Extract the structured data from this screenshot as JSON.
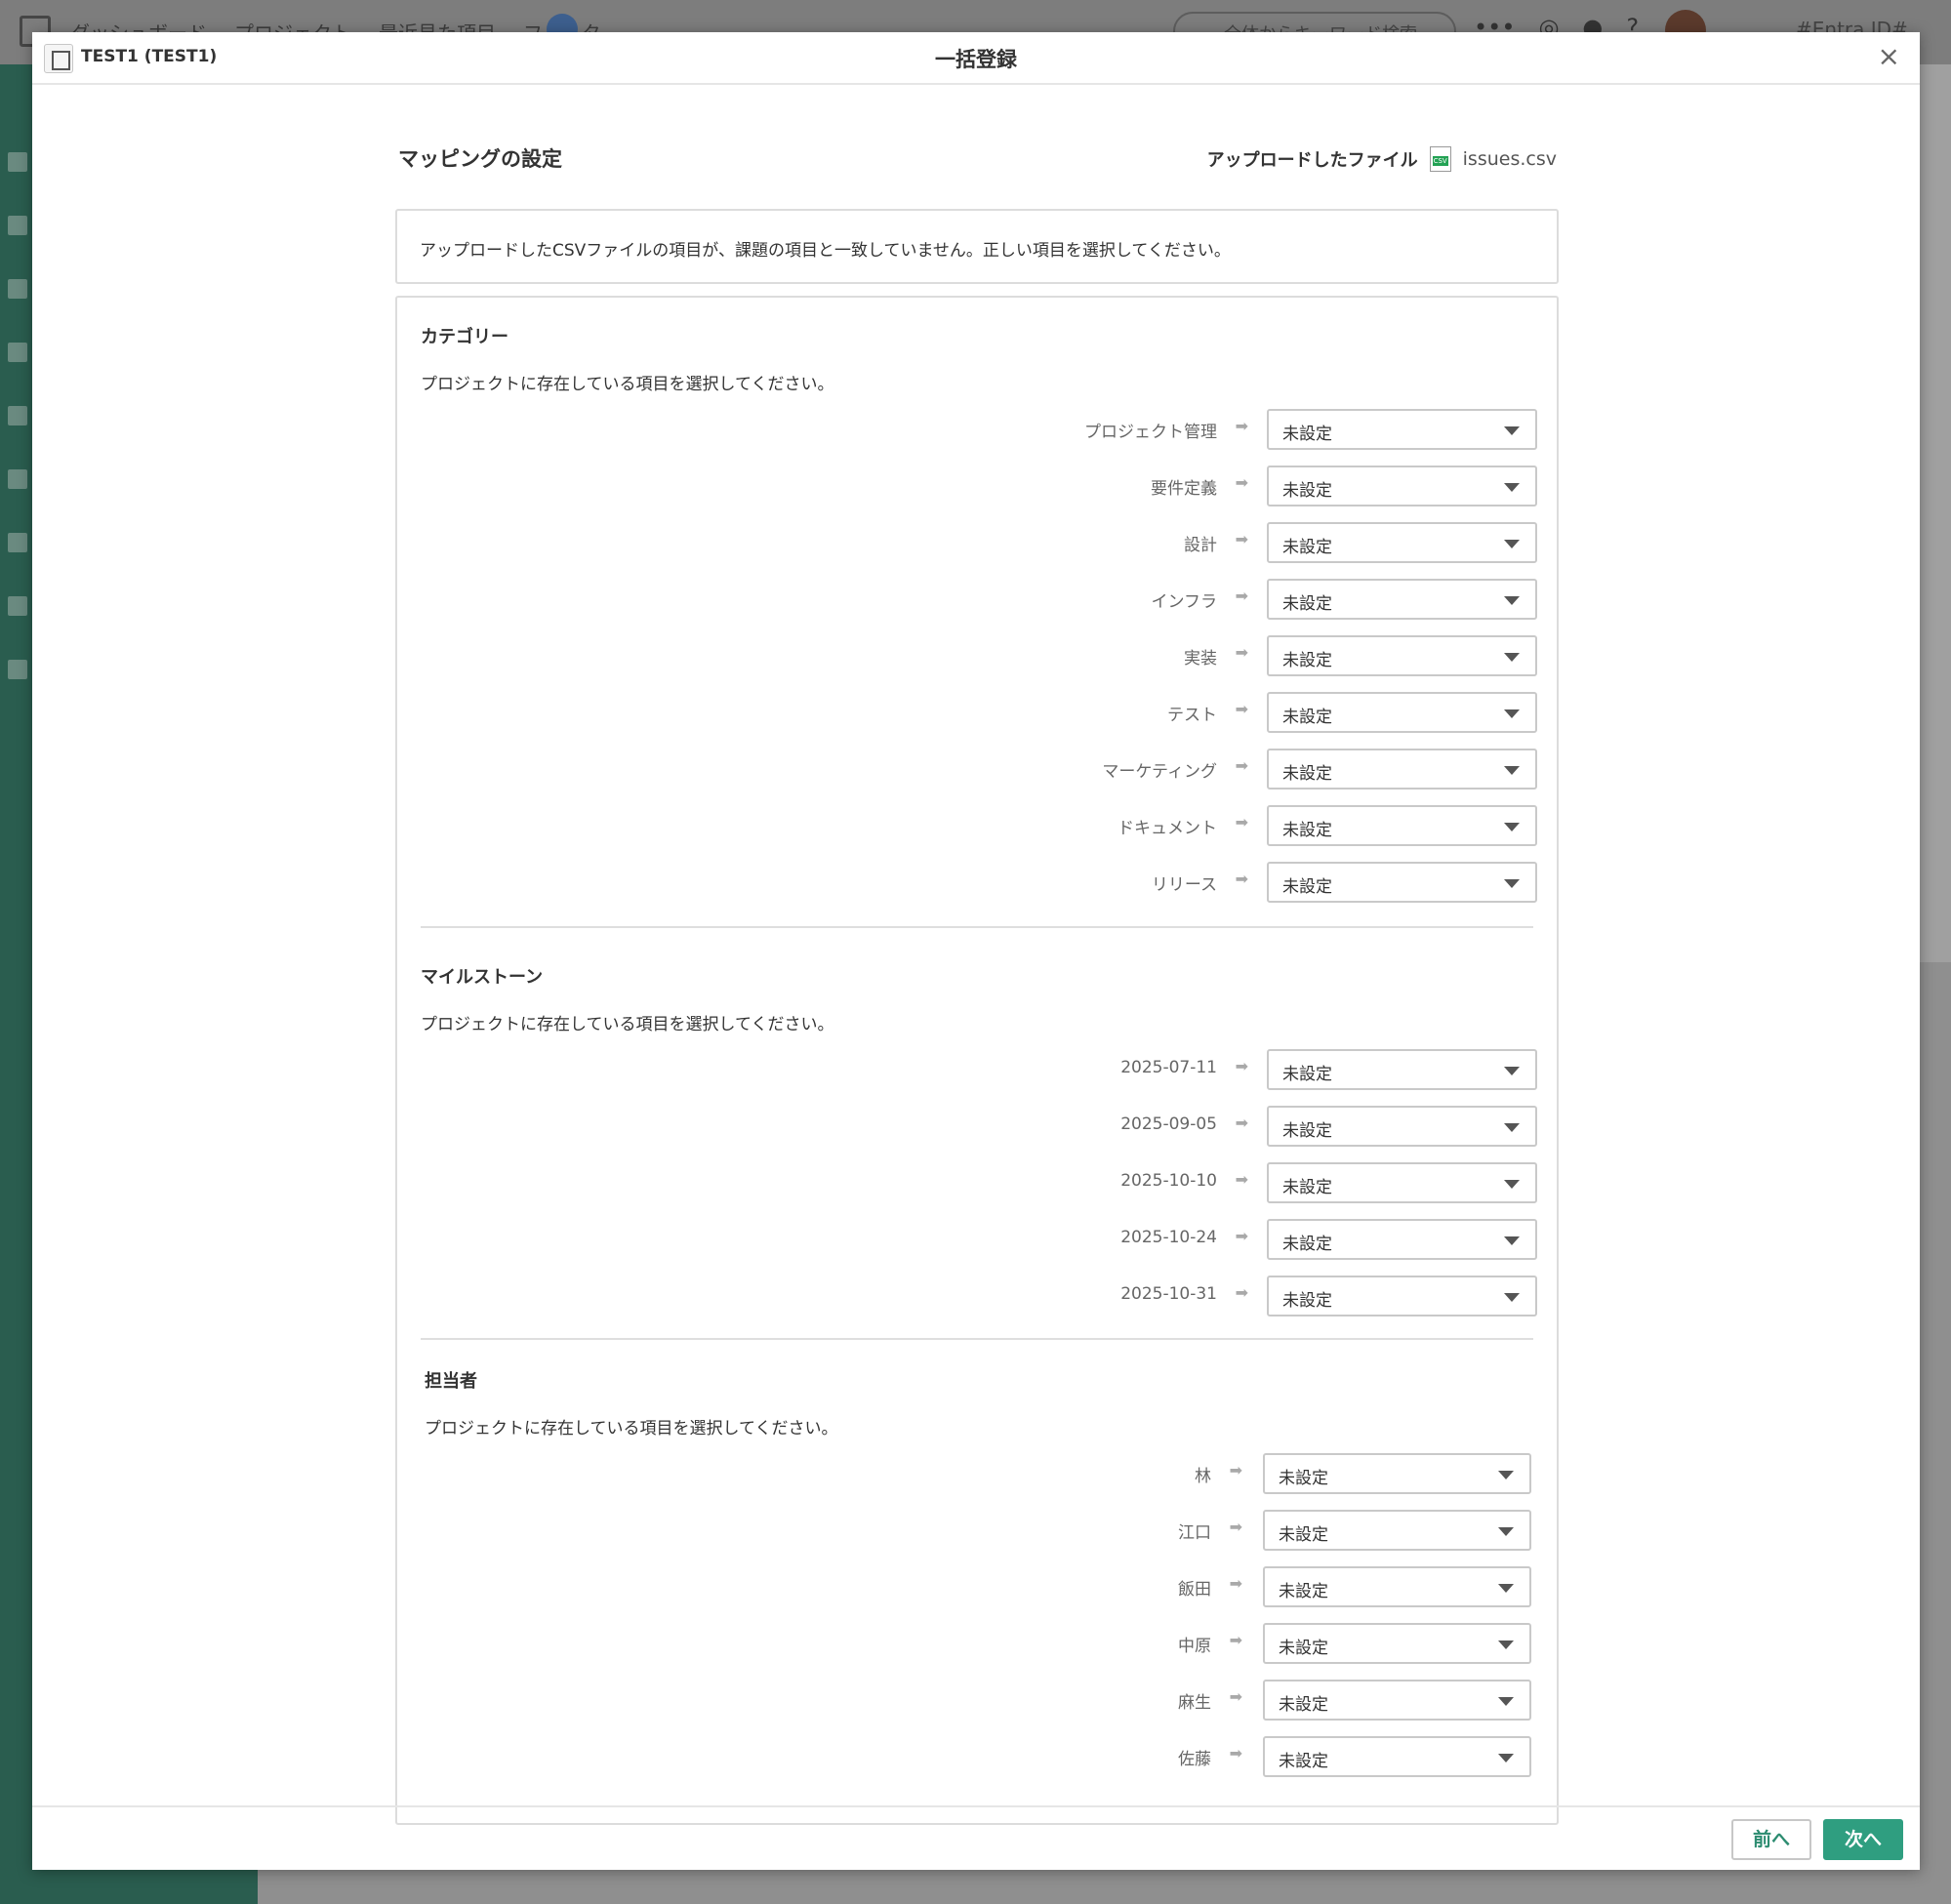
{
  "background": {
    "nav": [
      "ダッシュボード",
      "プロジェクト",
      "最近見た項目",
      "フィルタ"
    ],
    "search_placeholder": "全体からキーワード検索",
    "org_label": "#Entra ID#"
  },
  "modal": {
    "project_name": "TEST1 (TEST1)",
    "title": "一括登録",
    "close_label": "×"
  },
  "mapping": {
    "title": "マッピングの設定",
    "uploaded_label": "アップロードしたファイル",
    "file_name": "issues.csv",
    "notice": "アップロードしたCSVファイルの項目が、課題の項目と一致していません。正しい項目を選択してください。"
  },
  "sections": [
    {
      "title": "カテゴリー",
      "description": "プロジェクトに存在している項目を選択してください。",
      "rows": [
        {
          "source": "プロジェクト管理",
          "value": "未設定"
        },
        {
          "source": "要件定義",
          "value": "未設定"
        },
        {
          "source": "設計",
          "value": "未設定"
        },
        {
          "source": "インフラ",
          "value": "未設定"
        },
        {
          "source": "実装",
          "value": "未設定"
        },
        {
          "source": "テスト",
          "value": "未設定"
        },
        {
          "source": "マーケティング",
          "value": "未設定"
        },
        {
          "source": "ドキュメント",
          "value": "未設定"
        },
        {
          "source": "リリース",
          "value": "未設定"
        }
      ]
    },
    {
      "title": "マイルストーン",
      "description": "プロジェクトに存在している項目を選択してください。",
      "rows": [
        {
          "source": "2025-07-11",
          "value": "未設定"
        },
        {
          "source": "2025-09-05",
          "value": "未設定"
        },
        {
          "source": "2025-10-10",
          "value": "未設定"
        },
        {
          "source": "2025-10-24",
          "value": "未設定"
        },
        {
          "source": "2025-10-31",
          "value": "未設定"
        }
      ]
    },
    {
      "title": "担当者",
      "description": "プロジェクトに存在している項目を選択してください。",
      "rows": [
        {
          "source": "林",
          "value": "未設定"
        },
        {
          "source": "江口",
          "value": "未設定"
        },
        {
          "source": "飯田",
          "value": "未設定"
        },
        {
          "source": "中原",
          "value": "未設定"
        },
        {
          "source": "麻生",
          "value": "未設定"
        },
        {
          "source": "佐藤",
          "value": "未設定"
        }
      ]
    }
  ],
  "footer": {
    "prev_label": "前へ",
    "next_label": "次へ"
  },
  "colors": {
    "accent": "#2f9e80",
    "sidebar": "#2a5d4f"
  }
}
